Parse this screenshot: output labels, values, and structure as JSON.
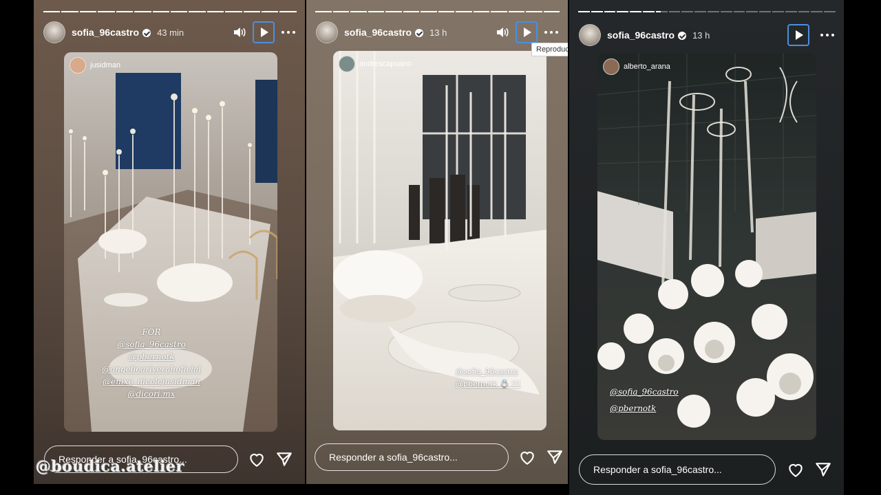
{
  "stories": [
    {
      "username": "sofia_96castro",
      "time": "43 min",
      "tagged_user": "jusidman",
      "mentions": [
        "FOR",
        "@sofia_96castro",
        "@pbernotk",
        "@angelicariverahoficial",
        "@enixe_nicolcjusidman",
        "@dicori.mx"
      ],
      "reply_placeholder": "Responder a sofia_96castro...",
      "icons": [
        "volume-icon",
        "play-icon",
        "more-icon",
        "heart-icon",
        "send-icon"
      ]
    },
    {
      "username": "sofia_96castro",
      "time": "13 h",
      "tagged_user": "andrescapuano",
      "mentions": [
        "@sofia_96castro",
        "@pbernotk 💍 !!!"
      ],
      "tooltip": "Reproduc",
      "reply_placeholder": "Responder a sofia_96castro...",
      "icons": [
        "volume-icon",
        "play-icon",
        "more-icon",
        "heart-icon",
        "send-icon"
      ]
    },
    {
      "username": "sofia_96castro",
      "time": "13 h",
      "tagged_user": "alberto_arana",
      "mentions": [
        "@sofia_96castro",
        "@pbernotk"
      ],
      "reply_placeholder": "Responder a sofia_96castro...",
      "icons": [
        "play-icon",
        "more-icon",
        "heart-icon",
        "send-icon"
      ]
    }
  ],
  "watermark": "@boudica.atelier",
  "colors": {
    "focus_outline": "#4a90e2",
    "panel1_bg": "#5c4c41",
    "panel2_bg": "#7a6d5f",
    "panel3_bg": "#1c1f20"
  }
}
